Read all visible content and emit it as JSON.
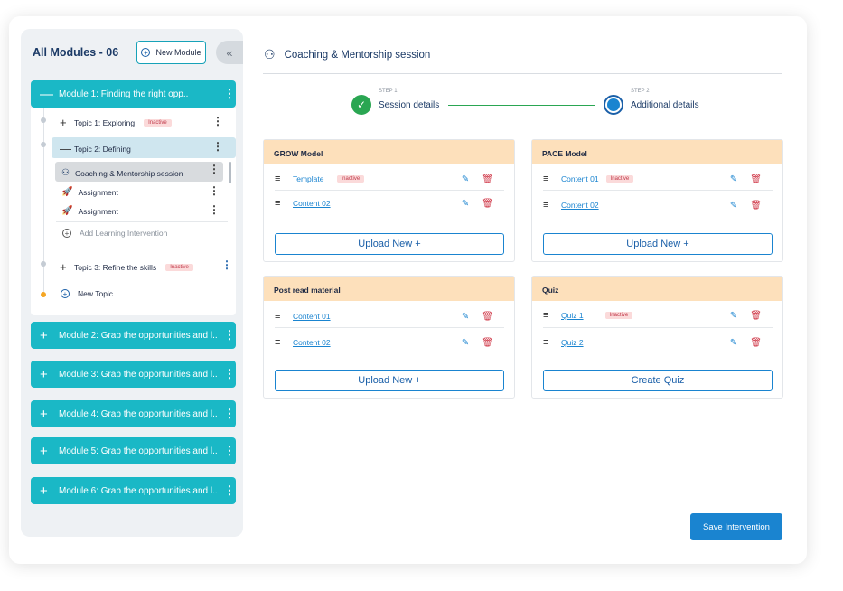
{
  "sidebar": {
    "title": "All Modules - 06",
    "new_module": "New Module",
    "collapse_icon": "«",
    "modules": [
      {
        "label": "Module 1: Finding the right opp.."
      },
      {
        "label": "Module 2: Grab the opportunities and l.."
      },
      {
        "label": "Module 3: Grab the opportunities and l.."
      },
      {
        "label": "Module 4: Grab the opportunities and l.."
      },
      {
        "label": "Module 5: Grab the opportunities and l.."
      },
      {
        "label": "Module 6: Grab the opportunities and l.."
      }
    ],
    "topics": [
      {
        "label": "Topic 1: Exploring",
        "badge": "Inactive"
      },
      {
        "label": "Topic 2: Defining"
      },
      {
        "label": "Topic 3: Refine the skills",
        "badge": "Inactive"
      }
    ],
    "sub_items": [
      {
        "label": "Coaching & Mentorship session",
        "icon": "people-icon"
      },
      {
        "label": "Assignment",
        "icon": "rocket-icon"
      },
      {
        "label": "Assignment",
        "icon": "rocket-icon"
      }
    ],
    "add_li": "Add Learning Intervention",
    "new_topic": "New Topic"
  },
  "header": {
    "title": "Coaching & Mentorship session"
  },
  "steps": [
    {
      "step": "STEP 1",
      "label": "Session details"
    },
    {
      "step": "STEP 2",
      "label": "Additional details"
    }
  ],
  "panels": [
    {
      "title": "GROW Model",
      "items": [
        {
          "name": "Template",
          "badge": "Inactive"
        },
        {
          "name": "Content 02"
        }
      ],
      "button": "Upload New +"
    },
    {
      "title": "PACE Model",
      "items": [
        {
          "name": "Content 01",
          "badge": "Inactive"
        },
        {
          "name": "Content 02"
        }
      ],
      "button": "Upload New +"
    },
    {
      "title": "Post read material",
      "items": [
        {
          "name": "Content 01"
        },
        {
          "name": "Content 02"
        }
      ],
      "button": "Upload New +"
    },
    {
      "title": "Quiz",
      "items": [
        {
          "name": "Quiz 1",
          "badge": "Inactive"
        },
        {
          "name": "Quiz 2"
        }
      ],
      "button": "Create Quiz"
    }
  ],
  "save_label": "Save Intervention",
  "colors": {
    "accent": "#1ab8c6",
    "primary": "#1a84d0",
    "success": "#2aa652",
    "panel_header": "#fde0bb",
    "inactive_bg": "#fbdada"
  }
}
